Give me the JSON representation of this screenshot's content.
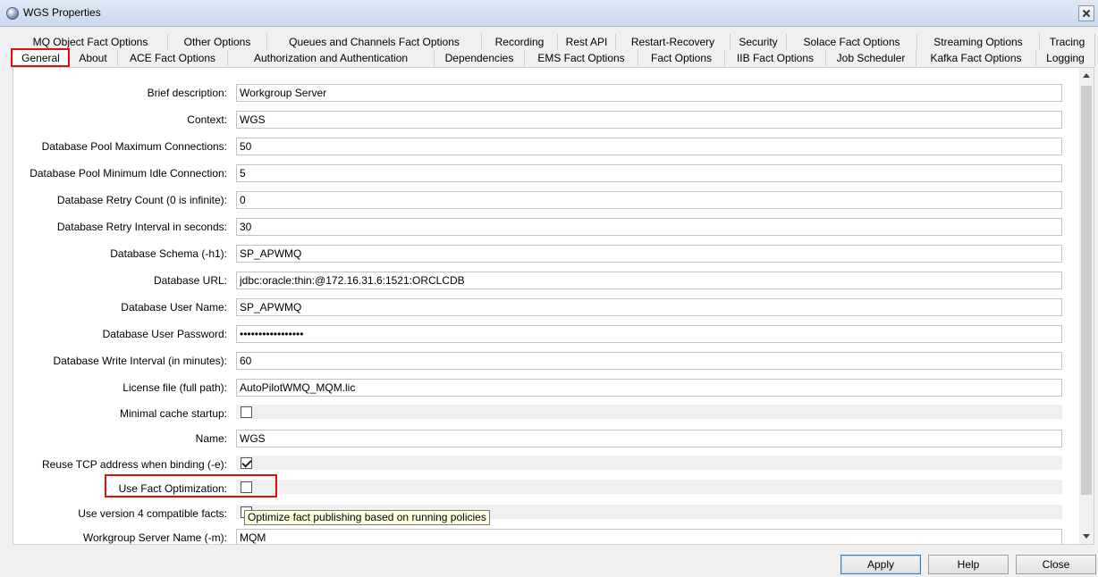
{
  "window": {
    "title": "WGS Properties"
  },
  "tabs_row1": [
    "MQ Object Fact Options",
    "Other Options",
    "Queues and Channels Fact Options",
    "Recording",
    "Rest API",
    "Restart-Recovery",
    "Security",
    "Solace Fact Options",
    "Streaming Options",
    "Tracing"
  ],
  "tabs_row2": [
    "General",
    "About",
    "ACE Fact Options",
    "Authorization and Authentication",
    "Dependencies",
    "EMS Fact Options",
    "Fact Options",
    "IIB Fact Options",
    "Job Scheduler",
    "Kafka Fact Options",
    "Logging"
  ],
  "selected_tab": "General",
  "fields": {
    "brief_description": {
      "label": "Brief description:",
      "value": "Workgroup Server"
    },
    "context": {
      "label": "Context:",
      "value": "WGS"
    },
    "db_pool_max": {
      "label": "Database Pool Maximum Connections:",
      "value": "50"
    },
    "db_pool_min_idle": {
      "label": "Database Pool Minimum Idle Connection:",
      "value": "5"
    },
    "db_retry_count": {
      "label": "Database Retry Count (0 is infinite):",
      "value": "0"
    },
    "db_retry_interval": {
      "label": "Database Retry Interval in seconds:",
      "value": "30"
    },
    "db_schema": {
      "label": "Database Schema (-h1):",
      "value": "SP_APWMQ"
    },
    "db_url": {
      "label": "Database URL:",
      "value": "jdbc:oracle:thin:@172.16.31.6:1521:ORCLCDB"
    },
    "db_user": {
      "label": "Database User Name:",
      "value": "SP_APWMQ"
    },
    "db_password": {
      "label": "Database User Password:",
      "value": "•••••••••••••••••"
    },
    "db_write_interval": {
      "label": "Database Write Interval (in minutes):",
      "value": "60"
    },
    "license_file": {
      "label": "License file (full path):",
      "value": "AutoPilotWMQ_MQM.lic"
    },
    "minimal_cache": {
      "label": "Minimal cache startup:",
      "checked": false
    },
    "name": {
      "label": "Name:",
      "value": "WGS"
    },
    "reuse_tcp": {
      "label": "Reuse TCP address when binding (-e):",
      "checked": true
    },
    "use_fact_optimization": {
      "label": "Use Fact Optimization:",
      "checked": false
    },
    "use_v4_facts": {
      "label": "Use version 4 compatible facts:",
      "checked": false
    },
    "wgs_name": {
      "label": "Workgroup Server Name (-m):",
      "value": "MQM"
    }
  },
  "tooltip": "Optimize fact publishing based on running policies",
  "buttons": {
    "apply": "Apply",
    "help": "Help",
    "close": "Close"
  },
  "colors": {
    "highlight": "#e01010",
    "tooltip_bg": "#ffffe1",
    "title_bar": "#dfe9f5"
  }
}
